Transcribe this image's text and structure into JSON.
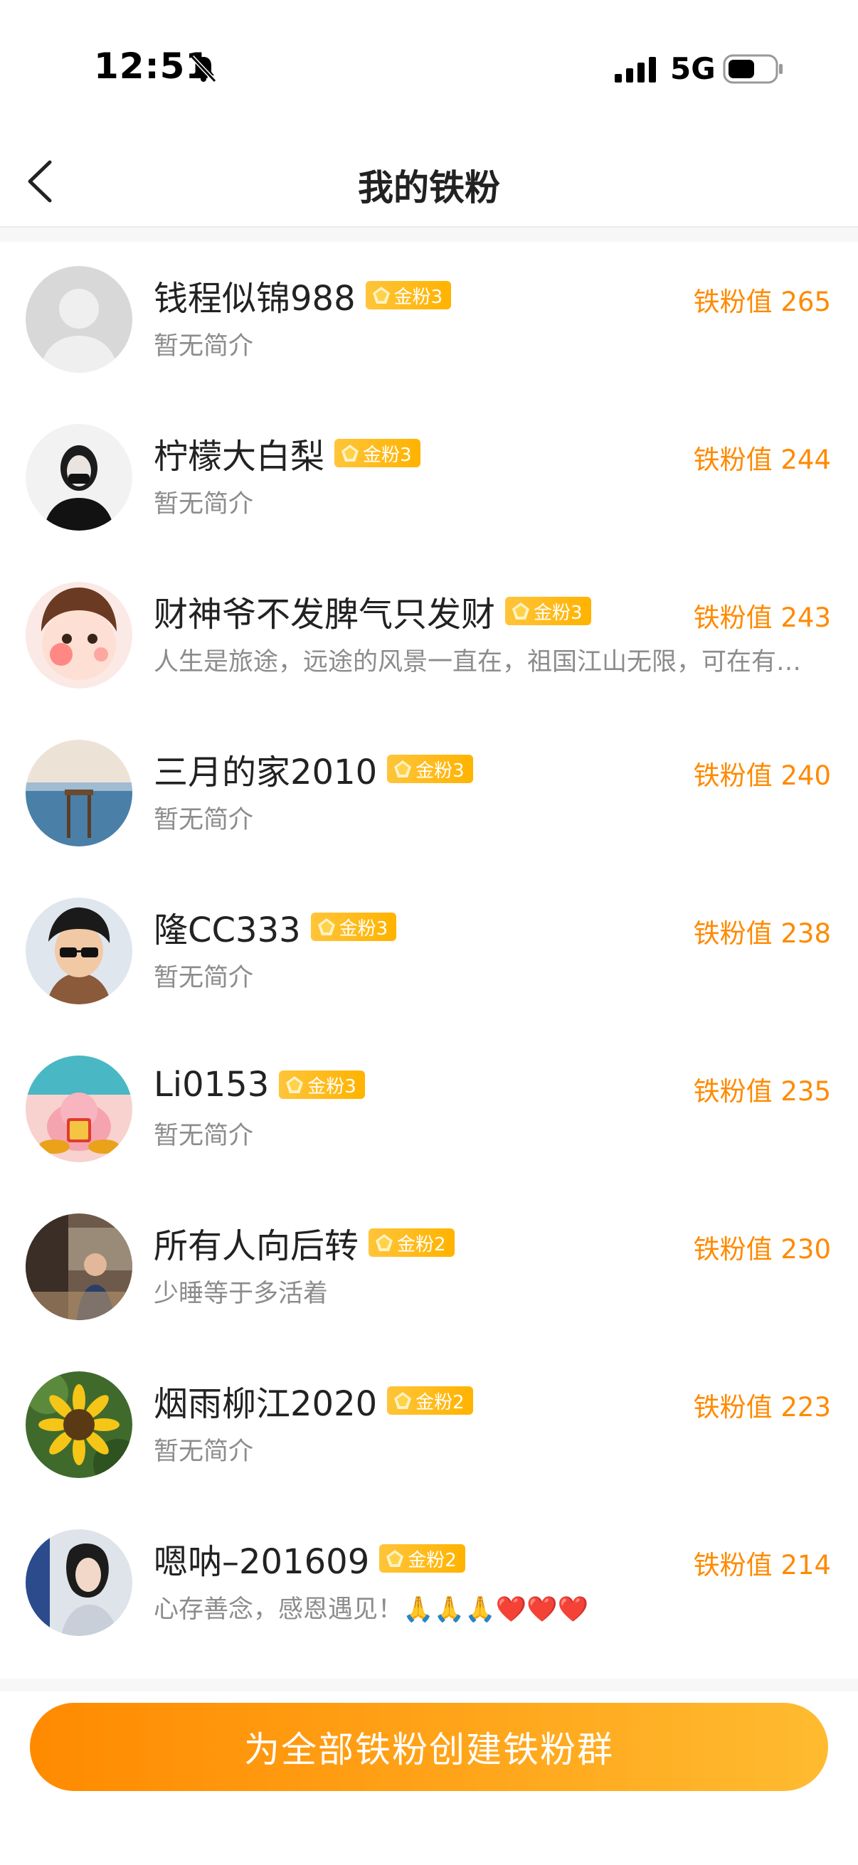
{
  "status_bar": {
    "time": "12:51",
    "network": "5G"
  },
  "nav": {
    "title": "我的铁粉"
  },
  "fans": [
    {
      "name": "钱程似锦988",
      "badge": "金粉3",
      "bio": "暂无简介",
      "value_label": "铁粉值 265",
      "value": 265,
      "avatar": "default-avatar"
    },
    {
      "name": "柠檬大白梨",
      "badge": "金粉3",
      "bio": "暂无简介",
      "value_label": "铁粉值 244",
      "value": 244,
      "avatar": "portrait-masked-woman"
    },
    {
      "name": "财神爷不发脾气只发财",
      "badge": "金粉3",
      "bio": "人生是旅途，远途的风景一直在，祖国江山无限，可在有生之年……",
      "value_label": "铁粉值 243",
      "value": 243,
      "avatar": "cartoon-girl"
    },
    {
      "name": "三月的家2010",
      "badge": "金粉3",
      "bio": "暂无简介",
      "value_label": "铁粉值 240",
      "value": 240,
      "avatar": "seaside-pier"
    },
    {
      "name": "隆CC333",
      "badge": "金粉3",
      "bio": "暂无简介",
      "value_label": "铁粉值 238",
      "value": 238,
      "avatar": "anime-sunglasses-boy"
    },
    {
      "name": "Li0153",
      "badge": "金粉3",
      "bio": "暂无简介",
      "value_label": "铁粉值 235",
      "value": 235,
      "avatar": "lucky-pig"
    },
    {
      "name": "所有人向后转",
      "badge": "金粉2",
      "bio": "少睡等于多活着",
      "value_label": "铁粉值 230",
      "value": 230,
      "avatar": "street-photo"
    },
    {
      "name": "烟雨柳江2020",
      "badge": "金粉2",
      "bio": "暂无简介",
      "value_label": "铁粉值 223",
      "value": 223,
      "avatar": "sunflower"
    },
    {
      "name": "嗯呐–201609",
      "badge": "金粉2",
      "bio": "心存善念，感恩遇见！🙏🙏🙏❤️❤️❤️",
      "value_label": "铁粉值 214",
      "value": 214,
      "avatar": "woman-portrait"
    }
  ],
  "actions": {
    "create_group_label": "为全部铁粉创建铁粉群"
  },
  "colors": {
    "accent": "#ff8a00",
    "badge": "#ffb300",
    "bio": "#8c8c8c"
  }
}
